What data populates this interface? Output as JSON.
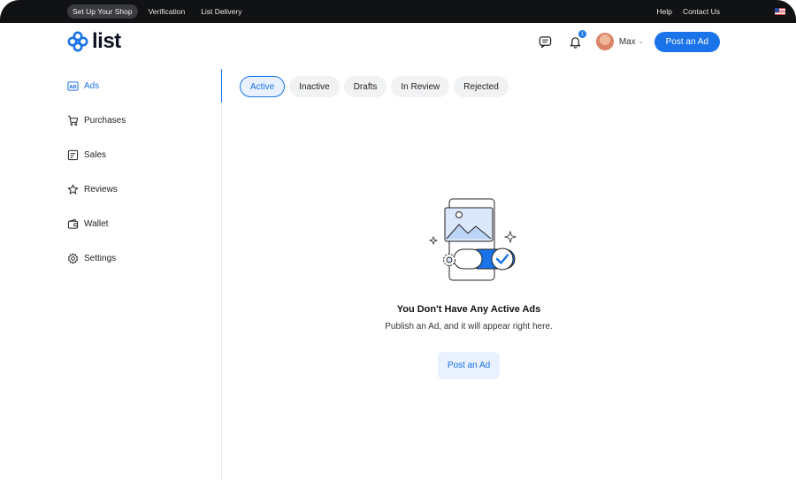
{
  "topbar": {
    "shop_label": "Set Up Your Shop",
    "verification": "Verification",
    "delivery": "List Delivery",
    "help": "Help",
    "contact": "Contact Us"
  },
  "header": {
    "logo_text": "list",
    "notification_count": "1",
    "user_name": "Max",
    "post_button": "Post an Ad"
  },
  "sidebar": {
    "items": [
      {
        "label": "Ads",
        "icon": "ad-icon"
      },
      {
        "label": "Purchases",
        "icon": "cart-icon"
      },
      {
        "label": "Sales",
        "icon": "receipt-icon"
      },
      {
        "label": "Reviews",
        "icon": "star-icon"
      },
      {
        "label": "Wallet",
        "icon": "wallet-icon"
      },
      {
        "label": "Settings",
        "icon": "gear-icon"
      }
    ]
  },
  "tabs": [
    {
      "label": "Active"
    },
    {
      "label": "Inactive"
    },
    {
      "label": "Drafts"
    },
    {
      "label": "In Review"
    },
    {
      "label": "Rejected"
    }
  ],
  "empty_state": {
    "title": "You Don't Have Any Active Ads",
    "subtitle": "Publish an Ad, and it will appear right here.",
    "button": "Post an Ad"
  },
  "colors": {
    "accent": "#1a73e8",
    "topbar_bg": "#111214",
    "tab_bg": "#f1f2f4"
  }
}
